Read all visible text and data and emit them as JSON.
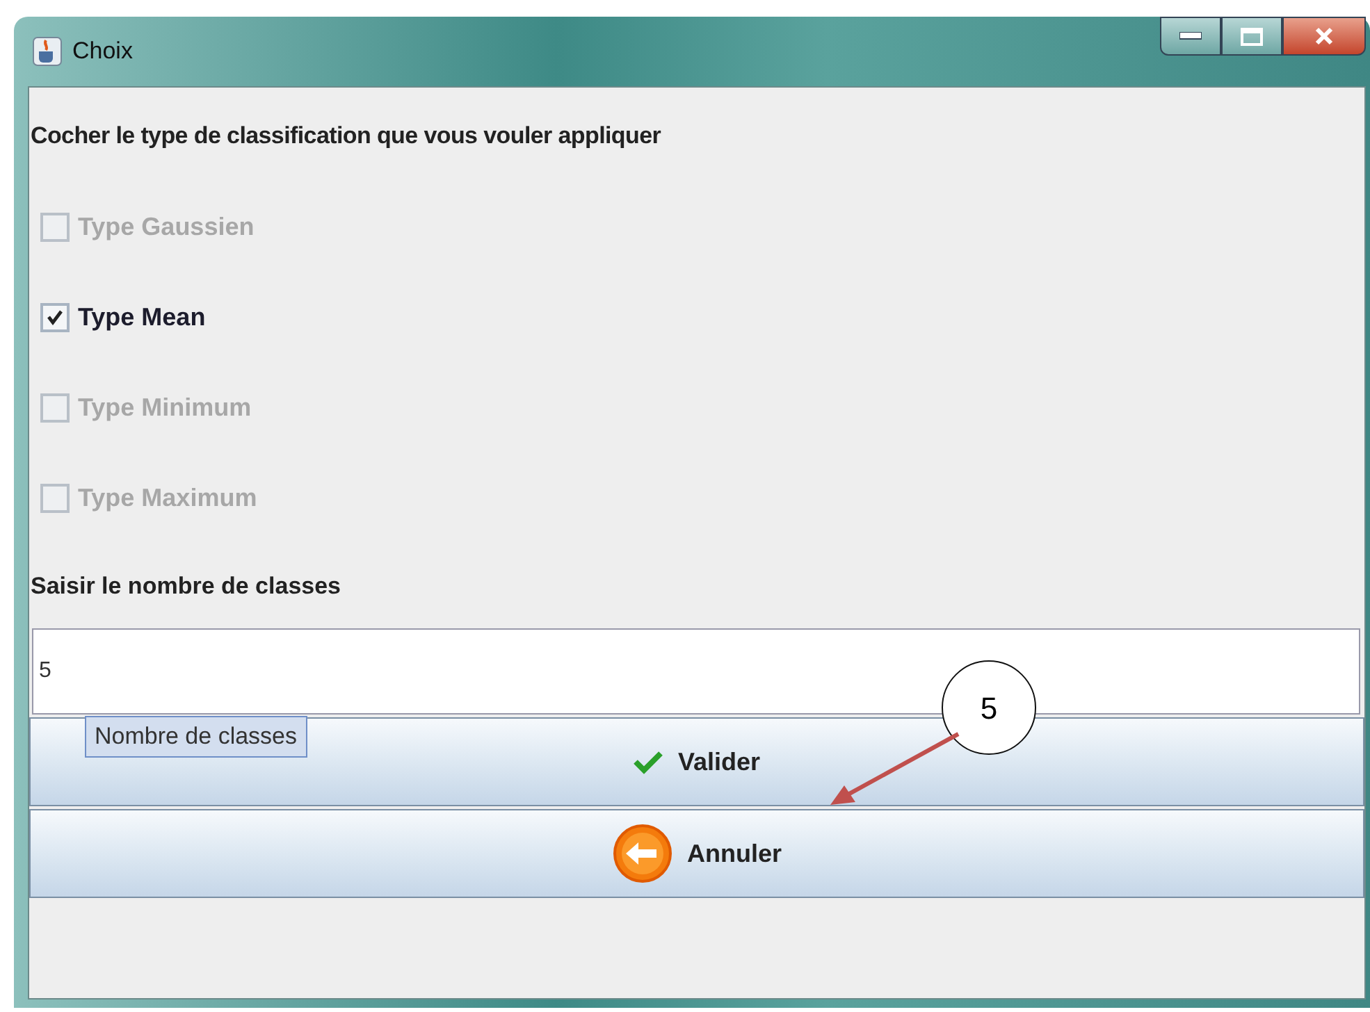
{
  "window": {
    "title": "Choix"
  },
  "heading": "Cocher le type de classification que vous vouler appliquer",
  "options": [
    {
      "label": "Type Gaussien",
      "checked": false,
      "disabled": true
    },
    {
      "label": "Type Mean",
      "checked": true,
      "disabled": false
    },
    {
      "label": "Type Minimum",
      "checked": false,
      "disabled": true
    },
    {
      "label": "Type Maximum",
      "checked": false,
      "disabled": true
    }
  ],
  "count_label": "Saisir le nombre de classes",
  "count_field": {
    "value": "5"
  },
  "tooltip": "Nombre de classes",
  "buttons": [
    {
      "label": "Valider",
      "kind": "confirm"
    },
    {
      "label": "Annuler",
      "kind": "cancel"
    }
  ],
  "callout": "5"
}
